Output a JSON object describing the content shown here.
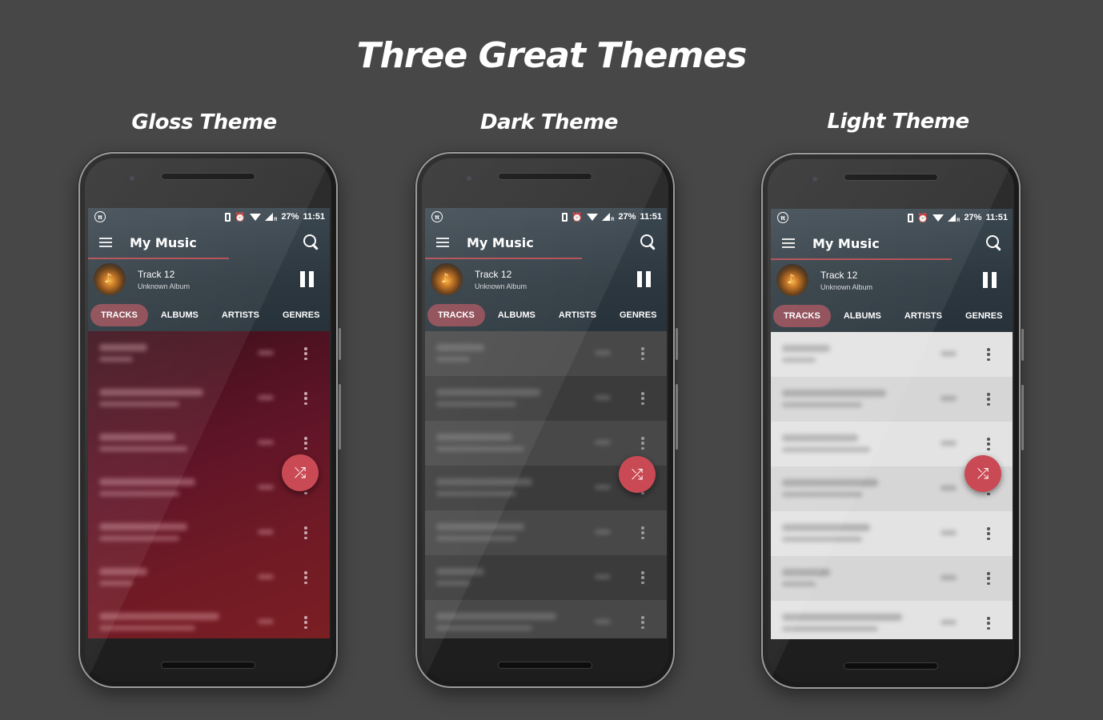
{
  "page": {
    "title": "Three Great Themes"
  },
  "colors": {
    "background": "#474747",
    "accent": "#c94a55",
    "active_tab": "#8a4650",
    "header": "#2c373f"
  },
  "phones": [
    {
      "theme_label": "Gloss Theme",
      "theme": "gloss",
      "status_bar": {
        "battery": "27%",
        "time": "11:51",
        "left_icon": "pi-icon",
        "icons": [
          "vibrate-icon",
          "alarm-icon",
          "wifi-icon",
          "signal-icon"
        ]
      },
      "toolbar": {
        "title": "My Music",
        "menu_icon": "menu-icon",
        "search_icon": "search-icon"
      },
      "now_playing": {
        "track": "Track 12",
        "album": "Unknown Album",
        "state": "playing"
      },
      "tabs": [
        {
          "label": "TRACKS",
          "active": true
        },
        {
          "label": "ALBUMS",
          "active": false
        },
        {
          "label": "ARTISTS",
          "active": false
        },
        {
          "label": "GENRES",
          "active": false
        }
      ],
      "list_rows": 7,
      "fab_icon": "shuffle-icon"
    },
    {
      "theme_label": "Dark Theme",
      "theme": "dark",
      "status_bar": {
        "battery": "27%",
        "time": "11:51",
        "left_icon": "pi-icon",
        "icons": [
          "vibrate-icon",
          "alarm-icon",
          "wifi-icon",
          "signal-icon"
        ]
      },
      "toolbar": {
        "title": "My Music",
        "menu_icon": "menu-icon",
        "search_icon": "search-icon"
      },
      "now_playing": {
        "track": "Track 12",
        "album": "Unknown Album",
        "state": "playing"
      },
      "tabs": [
        {
          "label": "TRACKS",
          "active": true
        },
        {
          "label": "ALBUMS",
          "active": false
        },
        {
          "label": "ARTISTS",
          "active": false
        },
        {
          "label": "GENRES",
          "active": false
        }
      ],
      "list_rows": 7,
      "fab_icon": "shuffle-icon"
    },
    {
      "theme_label": "Light Theme",
      "theme": "light",
      "status_bar": {
        "battery": "27%",
        "time": "11:51",
        "left_icon": "pi-icon",
        "icons": [
          "vibrate-icon",
          "alarm-icon",
          "wifi-icon",
          "signal-icon"
        ]
      },
      "toolbar": {
        "title": "My Music",
        "menu_icon": "menu-icon",
        "search_icon": "search-icon"
      },
      "now_playing": {
        "track": "Track 12",
        "album": "Unknown Album",
        "state": "playing"
      },
      "tabs": [
        {
          "label": "TRACKS",
          "active": true
        },
        {
          "label": "ALBUMS",
          "active": false
        },
        {
          "label": "ARTISTS",
          "active": false
        },
        {
          "label": "GENRES",
          "active": false
        }
      ],
      "list_rows": 7,
      "fab_icon": "shuffle-icon"
    }
  ],
  "glyphs": {
    "pi": "π",
    "alarm": "⏰",
    "shuffle": "⤮",
    "note": "♪",
    "signal_r": "R"
  }
}
